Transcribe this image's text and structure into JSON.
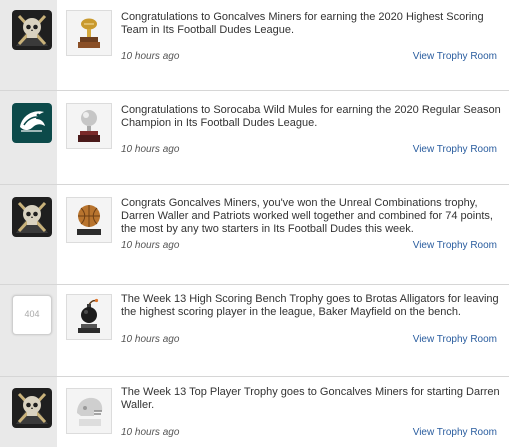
{
  "feed": {
    "items": [
      {
        "avatar_icon": "goncalves-miners-skull-logo",
        "trophy_icon": "gold-football-trophy",
        "message": "Congratulations to Goncalves Miners for earning the 2020 Highest Scoring Team in Its Football Dudes League.",
        "time": "10 hours ago",
        "link": "View Trophy Room"
      },
      {
        "avatar_icon": "sorocaba-wild-mules-eagle-logo",
        "trophy_icon": "silver-ball-trophy",
        "message": "Congratulations to Sorocaba Wild Mules for earning the 2020 Regular Season Champion in Its Football Dudes League.",
        "time": "10 hours ago",
        "link": "View Trophy Room"
      },
      {
        "avatar_icon": "goncalves-miners-skull-logo",
        "trophy_icon": "basketball-trophy",
        "message": "Congrats Goncalves Miners, you've won the Unreal Combinations trophy, Darren Waller and Patriots worked well together and combined for 74 points, the most by any two starters in Its Football Dudes this week.",
        "time": "10 hours ago",
        "link": "View Trophy Room"
      },
      {
        "avatar_icon": "missing-image-icon",
        "avatar_text": "404",
        "trophy_icon": "bomb-trophy",
        "message": "The Week 13 High Scoring Bench Trophy goes to Brotas Alligators for leaving the highest scoring player in the league, Baker Mayfield on the bench.",
        "time": "10 hours ago",
        "link": "View Trophy Room"
      },
      {
        "avatar_icon": "goncalves-miners-skull-logo",
        "trophy_icon": "silver-helmet-trophy",
        "message": "The Week 13 Top Player Trophy goes to Goncalves Miners for starting Darren Waller.",
        "time": "10 hours ago",
        "link": "View Trophy Room"
      }
    ]
  },
  "colors": {
    "rail": "#e9e9e9",
    "link": "#2a5d9f",
    "eagle_background": "#0c4a4a"
  }
}
